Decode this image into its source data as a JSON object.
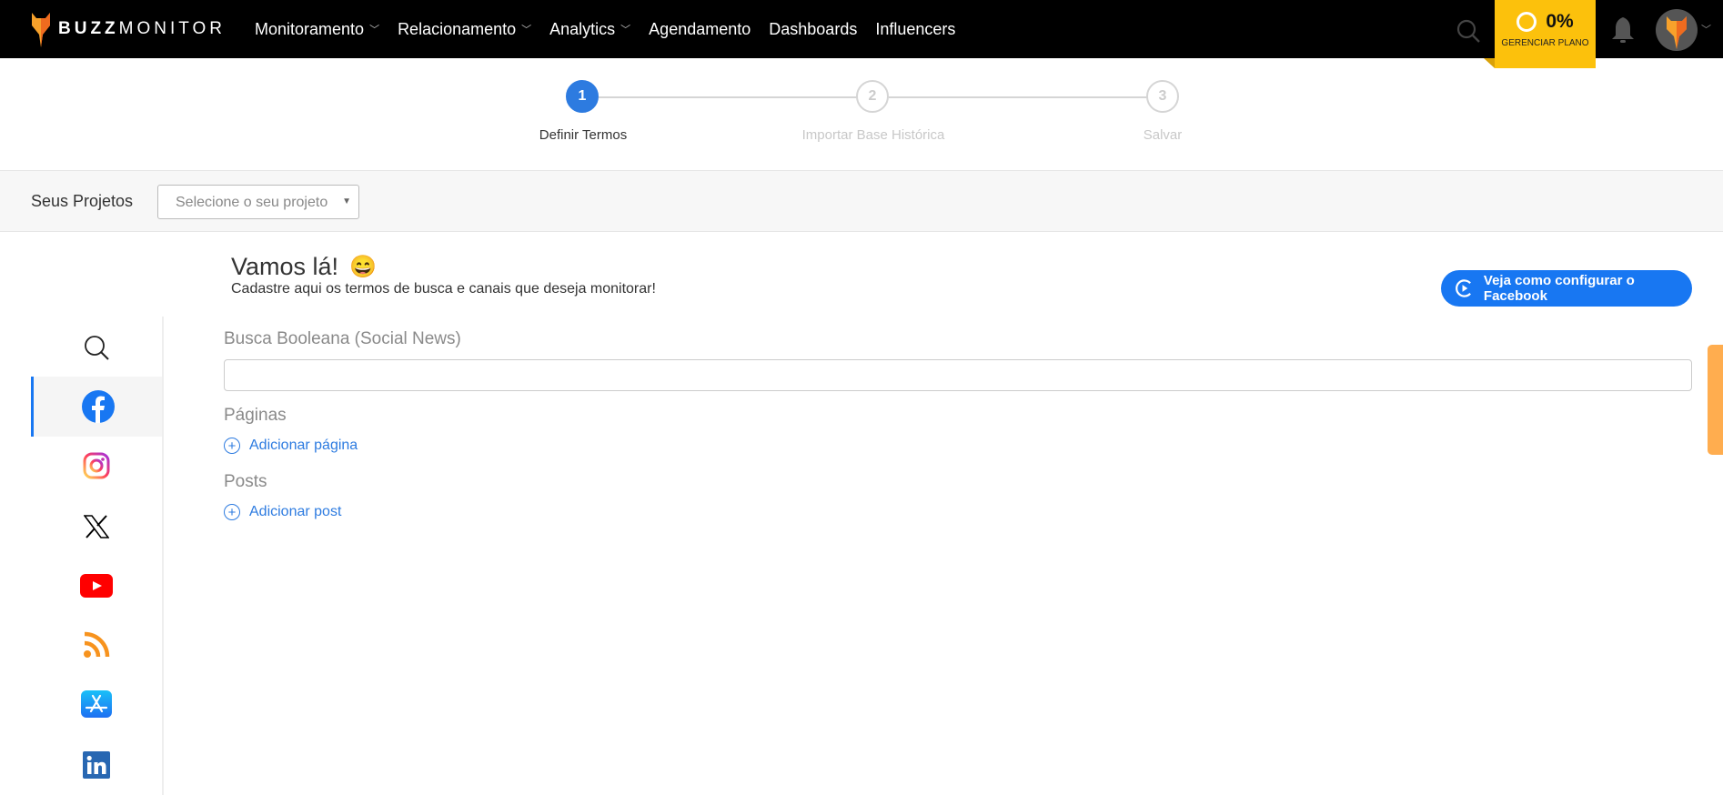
{
  "header": {
    "brand_bold": "BUZZ",
    "brand_light": "MONITOR",
    "nav": [
      {
        "label": "Monitoramento",
        "dropdown": true
      },
      {
        "label": "Relacionamento",
        "dropdown": true
      },
      {
        "label": "Analytics",
        "dropdown": true
      },
      {
        "label": "Agendamento"
      },
      {
        "label": "Dashboards"
      },
      {
        "label": "Influencers"
      }
    ],
    "plan": {
      "percent": "0%",
      "label": "GERENCIAR PLANO",
      "color": "#fcc10c"
    }
  },
  "stepper": {
    "steps": [
      {
        "num": "1",
        "label": "Definir Termos",
        "active": true
      },
      {
        "num": "2",
        "label": "Importar Base Histórica"
      },
      {
        "num": "3",
        "label": "Salvar"
      }
    ]
  },
  "projects": {
    "label": "Seus Projetos",
    "placeholder": "Selecione o seu projeto"
  },
  "main": {
    "title": "Vamos lá!",
    "emoji": "😄",
    "subtitle": "Cadastre aqui os termos de busca e canais que deseja monitorar!",
    "video_button": "Veja como configurar o Facebook",
    "boolean_label": "Busca Booleana (Social News)",
    "boolean_value": "",
    "pages_label": "Páginas",
    "add_page": "Adicionar página",
    "posts_label": "Posts",
    "add_post": "Adicionar post"
  },
  "sidebar": {
    "items": [
      "search-icon",
      "facebook-icon",
      "instagram-icon",
      "x-icon",
      "youtube-icon",
      "rss-icon",
      "app-store-icon",
      "linkedin-icon"
    ],
    "active": "facebook-icon"
  },
  "colors": {
    "accent": "#2d7be0",
    "facebook": "#1877f2"
  }
}
